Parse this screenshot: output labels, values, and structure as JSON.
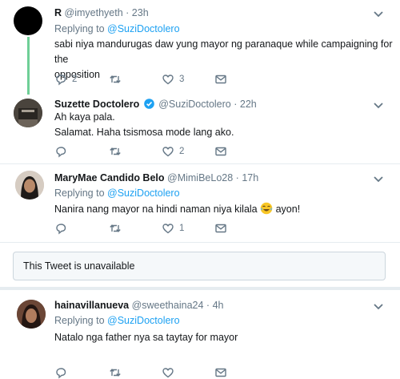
{
  "tweets": [
    {
      "name": "R",
      "handle": "@imyethyeth",
      "time": "23h",
      "reply_label": "Replying to",
      "reply_mention": "@SuziDoctolero",
      "text_lines": [
        "sabi niya mandurugas daw yung mayor ng paranaque while campaigning for the",
        "opposition"
      ],
      "replies": "2",
      "retweets": "",
      "likes": "3"
    },
    {
      "name": "Suzette Doctolero",
      "handle": "@SuziDoctolero",
      "time": "22h",
      "verified": true,
      "text_lines": [
        "Ah kaya pala.",
        "Salamat.  Haha tsismosa mode lang ako."
      ],
      "replies": "",
      "retweets": "",
      "likes": "2"
    },
    {
      "name": "MaryMae Candido Belo",
      "handle": "@MimiBeLo28",
      "time": "17h",
      "reply_label": "Replying to",
      "reply_mention": "@SuziDoctolero",
      "text_before_emoji": "Nanira nang mayor na hindi naman niya kilala",
      "emoji": "face-with-tears-of-joy",
      "text_after_emoji": "ayon!",
      "replies": "",
      "retweets": "",
      "likes": "1"
    },
    {
      "name": "hainavillanueva",
      "handle": "@sweethaina24",
      "time": "4h",
      "reply_label": "Replying to",
      "reply_mention": "@SuziDoctolero",
      "text_lines": [
        "Natalo nga father nya sa taytay for mayor"
      ]
    }
  ],
  "unavailable_text": "This Tweet is unavailable",
  "separator": "·",
  "colors": {
    "accent": "#1da1f2",
    "thread": "#6fcf97",
    "muted": "#657786"
  },
  "icons": [
    "reply-icon",
    "retweet-icon",
    "like-icon",
    "message-icon",
    "chevron-down-icon",
    "verified-badge-icon"
  ]
}
